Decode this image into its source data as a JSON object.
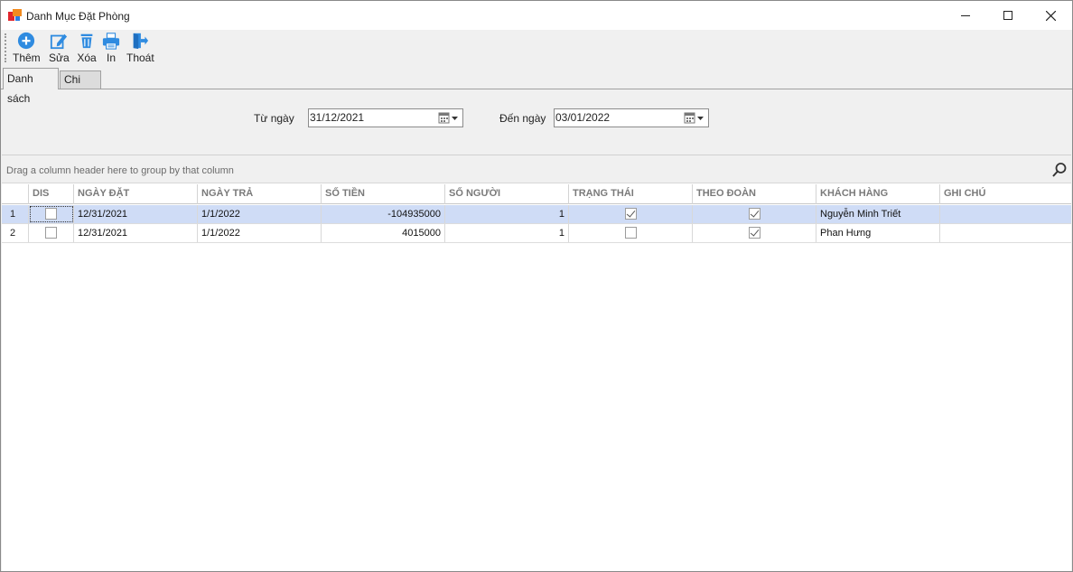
{
  "window": {
    "title": "Danh Mục Đặt Phòng"
  },
  "toolbar": {
    "items": [
      {
        "label": "Thêm",
        "icon": "add-circle-icon"
      },
      {
        "label": "Sửa",
        "icon": "edit-icon"
      },
      {
        "label": "Xóa",
        "icon": "trash-icon"
      },
      {
        "label": "In",
        "icon": "printer-icon"
      },
      {
        "label": "Thoát",
        "icon": "exit-icon"
      }
    ]
  },
  "tabs": [
    {
      "label": "Danh sách",
      "active": true
    },
    {
      "label": "Chi Tiết",
      "active": false
    }
  ],
  "filter": {
    "from_label": "Từ ngày",
    "from_value": "31/12/2021",
    "to_label": "Đến ngày",
    "to_value": "03/01/2022"
  },
  "grid": {
    "group_hint": "Drag a column header here to group by that column",
    "columns": [
      "DIS",
      "NGÀY ĐẶT",
      "NGÀY TRẢ",
      "SỐ TIỀN",
      "SỐ NGƯỜI",
      "TRẠNG THÁI",
      "THEO ĐOÀN",
      "KHÁCH HÀNG",
      "GHI CHÚ"
    ],
    "rows": [
      {
        "num": "1",
        "dis": false,
        "ngay_dat": "12/31/2021",
        "ngay_tra": "1/1/2022",
        "so_tien": "-104935000",
        "so_nguoi": "1",
        "trang_thai": true,
        "theo_doan": true,
        "khach_hang": "Nguyễn Minh Triết",
        "ghi_chu": ""
      },
      {
        "num": "2",
        "dis": false,
        "ngay_dat": "12/31/2021",
        "ngay_tra": "1/1/2022",
        "so_tien": "4015000",
        "so_nguoi": "1",
        "trang_thai": false,
        "theo_doan": true,
        "khach_hang": "Phan Hưng",
        "ghi_chu": ""
      }
    ]
  },
  "colors": {
    "selected_row": "#cfdcf6",
    "toolbar_icon_blue": "#2f8be0"
  }
}
